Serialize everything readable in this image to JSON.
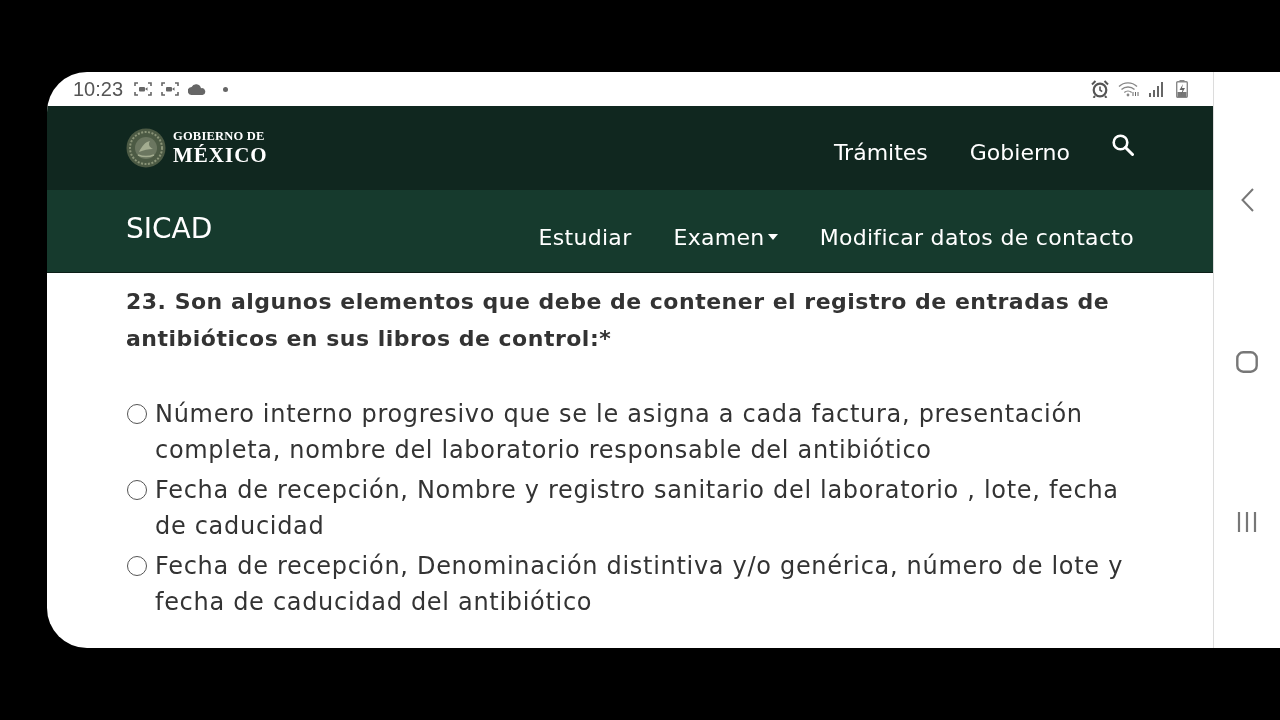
{
  "status_bar": {
    "time": "10:23"
  },
  "header": {
    "logo": {
      "line_1": "GOBIERNO DE",
      "line_2": "MÉXICO"
    },
    "links": [
      "Trámites",
      "Gobierno"
    ]
  },
  "subheader": {
    "title": "SICAD",
    "menu": [
      {
        "label": "Estudiar",
        "kind": "link"
      },
      {
        "label": "Examen",
        "kind": "dropdown"
      },
      {
        "label": "Modificar datos de contacto",
        "kind": "link"
      }
    ]
  },
  "question": {
    "text": "23. Son algunos elementos que debe de contener el registro de entradas de antibióticos en sus libros de control:*",
    "options": [
      {
        "label": "Número interno progresivo que se le asigna a cada factura, presentación completa, nombre del laboratorio responsable del antibiótico",
        "selected": false
      },
      {
        "label": "Fecha de recepción, Nombre y registro sanitario del laboratorio , lote, fecha de caducidad",
        "selected": false
      },
      {
        "label": "Fecha de recepción, Denominación distintiva y/o genérica, número de lote y fecha de caducidad del antibiótico",
        "selected": false
      }
    ]
  }
}
